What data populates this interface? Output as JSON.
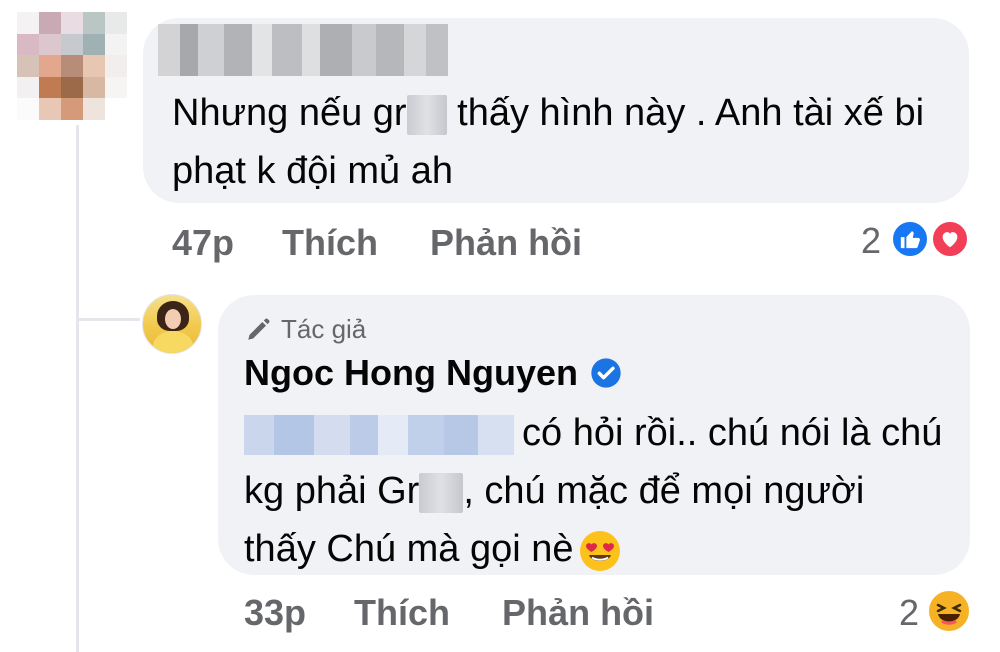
{
  "comment": {
    "text_before": "Nhưng nếu gr",
    "text_after": " thấy hình này . Anh tài xế bi phạt k đội mủ ah",
    "time": "47p",
    "like_label": "Thích",
    "reply_label": "Phản hồi",
    "reaction_count": "2",
    "reactions": [
      "like-icon",
      "love-icon"
    ]
  },
  "reply": {
    "author_badge": "Tác giả",
    "name": "Ngoc Hong Nguyen",
    "text_part1": "có hỏi rồi.. chú nói là chú kg phải Gr",
    "text_part2": ", chú mặc để mọi người thấy Chú mà gọi nè",
    "time": "33p",
    "like_label": "Thích",
    "reply_label": "Phản hồi",
    "reaction_count": "2",
    "reactions": [
      "haha-icon"
    ]
  },
  "colors": {
    "bubble": "#f0f2f5",
    "meta": "#65676b",
    "like": "#1877f2",
    "love": "#f33e58",
    "haha": "#f7b125"
  }
}
